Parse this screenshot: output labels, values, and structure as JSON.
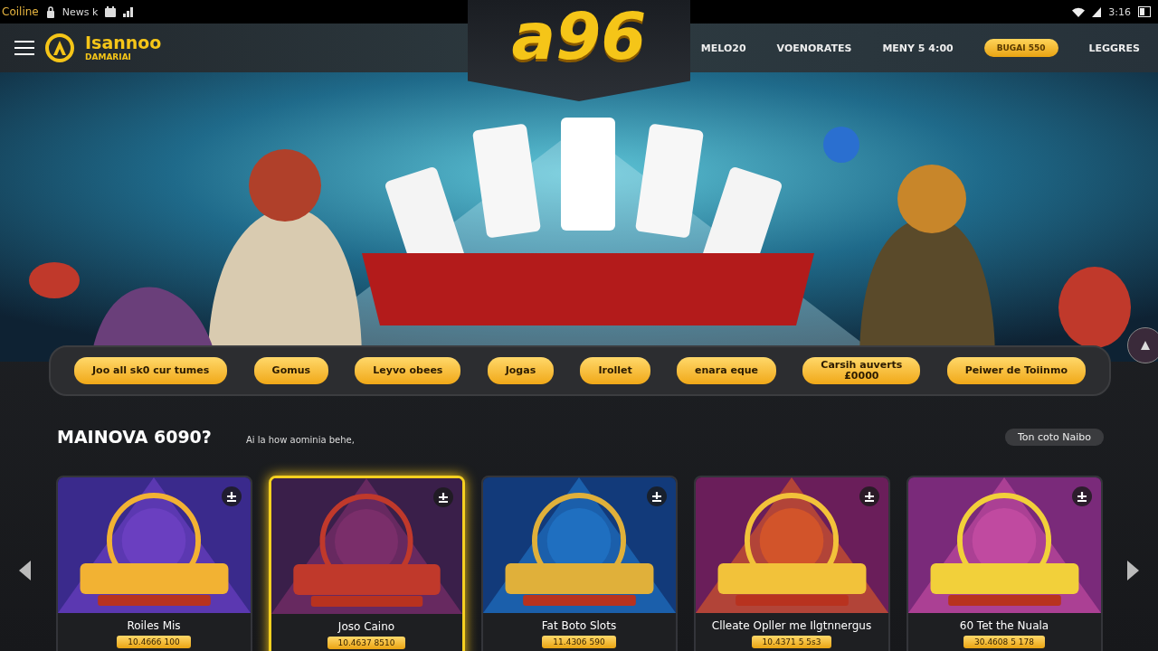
{
  "status_bar": {
    "carrier": "Coiline",
    "app": "News k",
    "time": "3:16"
  },
  "header": {
    "brand": "Isannoo",
    "brand_sub": "DAMARIAI",
    "nav": [
      {
        "label": "MELO20",
        "kind": "link"
      },
      {
        "label": "VOENORATES",
        "kind": "link"
      },
      {
        "label": "MENY 5 4:00",
        "kind": "link"
      },
      {
        "label": "BUGAI 550",
        "kind": "button"
      },
      {
        "label": "LEGGRES",
        "kind": "link"
      }
    ]
  },
  "logo": "a96",
  "categories": [
    "Joo all sk0 cur tumes",
    "Gomus",
    "Leyvo obees",
    "Jogas",
    "Irollet",
    "enara eque",
    "Carsih auverts\n£0000",
    "Peiwer de Toiinmo"
  ],
  "section": {
    "title": "MAINOVA 6090?",
    "subtitle": "Ai la how aominia behe,",
    "action": "Ton coto Naibo"
  },
  "games": [
    {
      "title": "Roiles Mis",
      "price": "10.4666 100",
      "selected": false
    },
    {
      "title": "Joso Caino",
      "price": "10.4637 8510",
      "selected": true
    },
    {
      "title": "Fat Boto Slots",
      "price": "11.4306 590",
      "selected": false
    },
    {
      "title": "Clleate Opller me Ilgtnnergus",
      "price": "10.4371 5 5s3",
      "selected": false
    },
    {
      "title": "60 Tet the Nuala",
      "price": "30.4608 5 178",
      "selected": false
    }
  ]
}
